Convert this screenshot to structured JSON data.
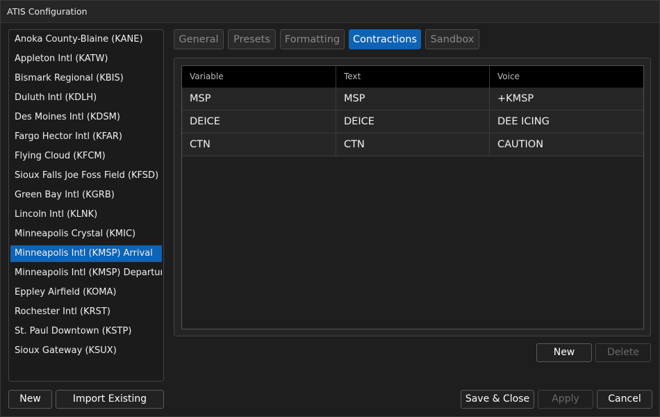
{
  "window": {
    "title": "ATIS Configuration"
  },
  "sidebar": {
    "items": [
      "Anoka County-Blaine (KANE)",
      "Appleton Intl (KATW)",
      "Bismark Regional (KBIS)",
      "Duluth Intl (KDLH)",
      "Des Moines Intl (KDSM)",
      "Fargo Hector Intl (KFAR)",
      "Flying Cloud (KFCM)",
      "Sioux Falls Joe Foss Field (KFSD)",
      "Green Bay Intl (KGRB)",
      "Lincoln Intl (KLNK)",
      "Minneapolis Crystal (KMIC)",
      "Minneapolis Intl (KMSP) Arrival",
      "Minneapolis Intl (KMSP) Departure",
      "Eppley Airfield (KOMA)",
      "Rochester Intl (KRST)",
      "St. Paul Downtown (KSTP)",
      "Sioux Gateway (KSUX)"
    ],
    "selected_index": 11,
    "new_label": "New",
    "import_label": "Import Existing"
  },
  "tabs": [
    "General",
    "Presets",
    "Formatting",
    "Contractions",
    "Sandbox"
  ],
  "active_tab": "Contractions",
  "contractions": {
    "columns": [
      "Variable",
      "Text",
      "Voice"
    ],
    "rows": [
      [
        "MSP",
        "MSP",
        "+KMSP"
      ],
      [
        "DEICE",
        "DEICE",
        "DEE ICING"
      ],
      [
        "CTN",
        "CTN",
        "CAUTION"
      ]
    ],
    "new_label": "New",
    "delete_label": "Delete"
  },
  "footer": {
    "save_close_label": "Save & Close",
    "apply_label": "Apply",
    "cancel_label": "Cancel"
  },
  "colors": {
    "accent": "#0e63b4",
    "background": "#1e1e1e"
  }
}
